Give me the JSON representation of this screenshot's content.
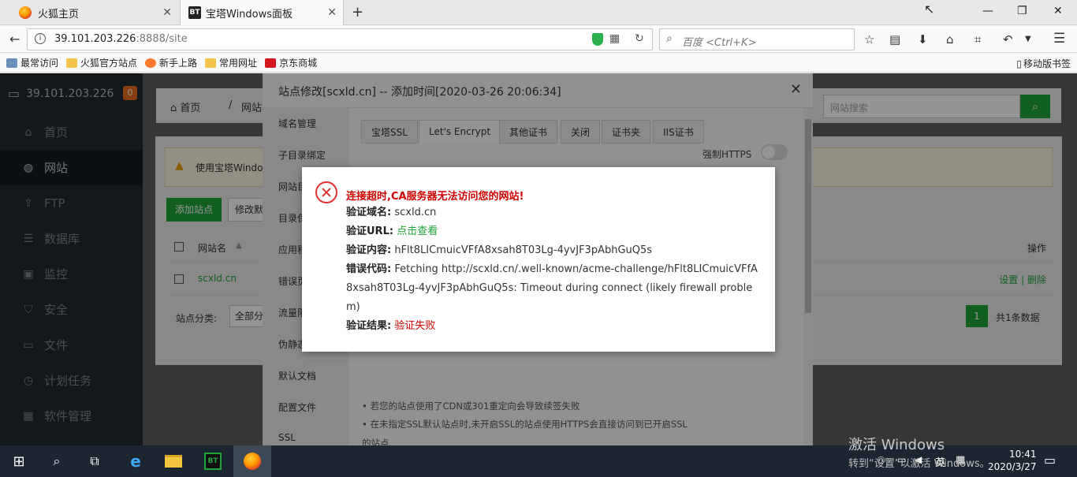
{
  "browser": {
    "tabs": [
      {
        "label": "火狐主页"
      },
      {
        "label": "宝塔Windows面板"
      }
    ],
    "url_host": "39.101.203.226",
    "url_rest": ":8888/site",
    "search_placeholder": "百度 <Ctrl+K>",
    "bookmarks": [
      {
        "label": "最常访问"
      },
      {
        "label": "火狐官方站点"
      },
      {
        "label": "新手上路"
      },
      {
        "label": "常用网址"
      },
      {
        "label": "京东商城"
      }
    ],
    "mobile_bookmarks": "移动版书签"
  },
  "sidebar": {
    "server_ip": "39.101.203.226",
    "badge": "0",
    "items": [
      {
        "label": "首页",
        "icon": "home-icon"
      },
      {
        "label": "网站",
        "icon": "globe-icon"
      },
      {
        "label": "FTP",
        "icon": "ftp-icon"
      },
      {
        "label": "数据库",
        "icon": "database-icon"
      },
      {
        "label": "监控",
        "icon": "monitor-icon"
      },
      {
        "label": "安全",
        "icon": "shield-icon"
      },
      {
        "label": "文件",
        "icon": "folder-icon"
      },
      {
        "label": "计划任务",
        "icon": "clock-icon"
      },
      {
        "label": "软件管理",
        "icon": "apps-icon"
      }
    ]
  },
  "content": {
    "breadcrumb_home": "首页",
    "breadcrumb_sep": "/",
    "breadcrumb_site": "网站管",
    "notice": "使用宝塔Windo",
    "add_site": "添加站点",
    "modify": "修改默",
    "site_search_placeholder": "网站搜索",
    "col_site_name": "网站名",
    "col_ops": "操作",
    "site_row_name": "scxld.cn",
    "site_row_settings": "设置",
    "site_row_delete": "删除",
    "category_label": "站点分类:",
    "category_value": "全部分",
    "page_num": "1",
    "total": "共1条数据"
  },
  "modal": {
    "title": "站点修改[scxld.cn] -- 添加时间[2020-03-26 20:06:34]",
    "left_items": [
      "域名管理",
      "子目录绑定",
      "网站目",
      "目录保",
      "应用程",
      "错误页",
      "流量限",
      "伪静态",
      "默认文档",
      "配置文件",
      "SSL"
    ],
    "cert_tabs": [
      "宝塔SSL",
      "Let's Encrypt",
      "其他证书",
      "关闭",
      "证书夹",
      "IIS证书"
    ],
    "https_label": "强制HTTPS",
    "tips": [
      "• 若您的站点使用了CDN或301重定向会导致续签失败",
      "• 在未指定SSL默认站点时,未开启SSL的站点使用HTTPS会直接访问到已开启SSL",
      "的站点"
    ]
  },
  "alert": {
    "title": "连接超时,CA服务器无法访问您的网站!",
    "domain_label": "验证域名:",
    "domain_value": "scxld.cn",
    "url_label": "验证URL:",
    "url_value": "点击查看",
    "content_label": "验证内容:",
    "content_value": "hFlt8LICmuicVFfA8xsah8T03Lg-4yvJF3pAbhGuQ5s",
    "error_label": "错误代码:",
    "error_value": "Fetching http://scxld.cn/.well-known/acme-challenge/hFlt8LICmuicVFfA8xsah8T03Lg-4yvJF3pAbhGuQ5s: Timeout during connect (likely firewall problem)",
    "result_label": "验证结果:",
    "result_value": "验证失败"
  },
  "os": {
    "watermark_line1": "激活 Windows",
    "watermark_line2": "转到“设置”以激活 Windows。",
    "time": "10:41",
    "date": "2020/3/27",
    "ime": "英"
  }
}
